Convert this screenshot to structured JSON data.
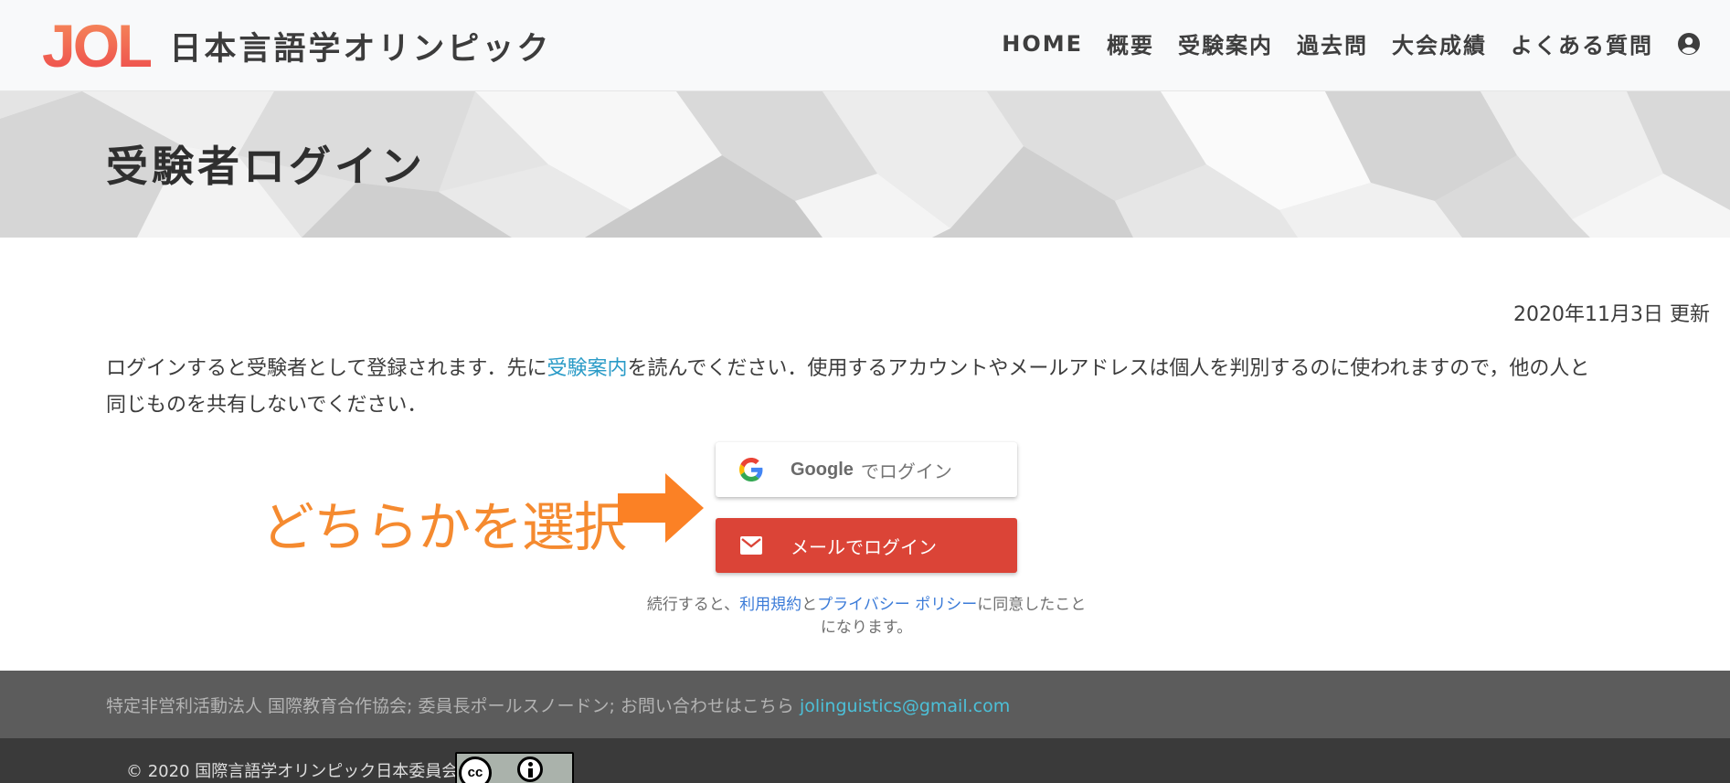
{
  "header": {
    "logo_text": "JOL",
    "site_name": "日本言語学オリンピック",
    "nav": [
      "HOME",
      "概要",
      "受験案内",
      "過去問",
      "大会成績",
      "よくある質問"
    ],
    "user_icon": "user-circle-icon"
  },
  "banner": {
    "title": "受験者ログイン"
  },
  "main": {
    "updated": "2020年11月3日 更新",
    "intro_before": "ログインすると受験者として登録されます．先に",
    "intro_link": "受験案内",
    "intro_after": "を読んでください．使用するアカウントやメールアドレスは個人を判別するのに使われますので，他の人と同じものを共有しないでください．",
    "callout": "どちらかを選択",
    "google_brand": "Google",
    "google_label": "でログイン",
    "mail_label": "メールでログイン",
    "terms_before": "続行すると、",
    "terms_link1": "利用規約",
    "terms_mid": "と",
    "terms_link2": "プライバシー ポリシー",
    "terms_after": "に同意したことになります。"
  },
  "footer": {
    "org": "特定非営利活動法人 国際教育合作協会; 委員長ポールスノードン; お問い合わせはこちら ",
    "email": "jolinguistics@gmail.com",
    "copyright": "© 2020 国際言語学オリンピック日本委員会",
    "license_badge": "cc-by-icon"
  },
  "colors": {
    "accent_link": "#2a9bc7",
    "mail_button": "#db4437",
    "callout": "#f58a2f",
    "logo": "#f26450"
  }
}
